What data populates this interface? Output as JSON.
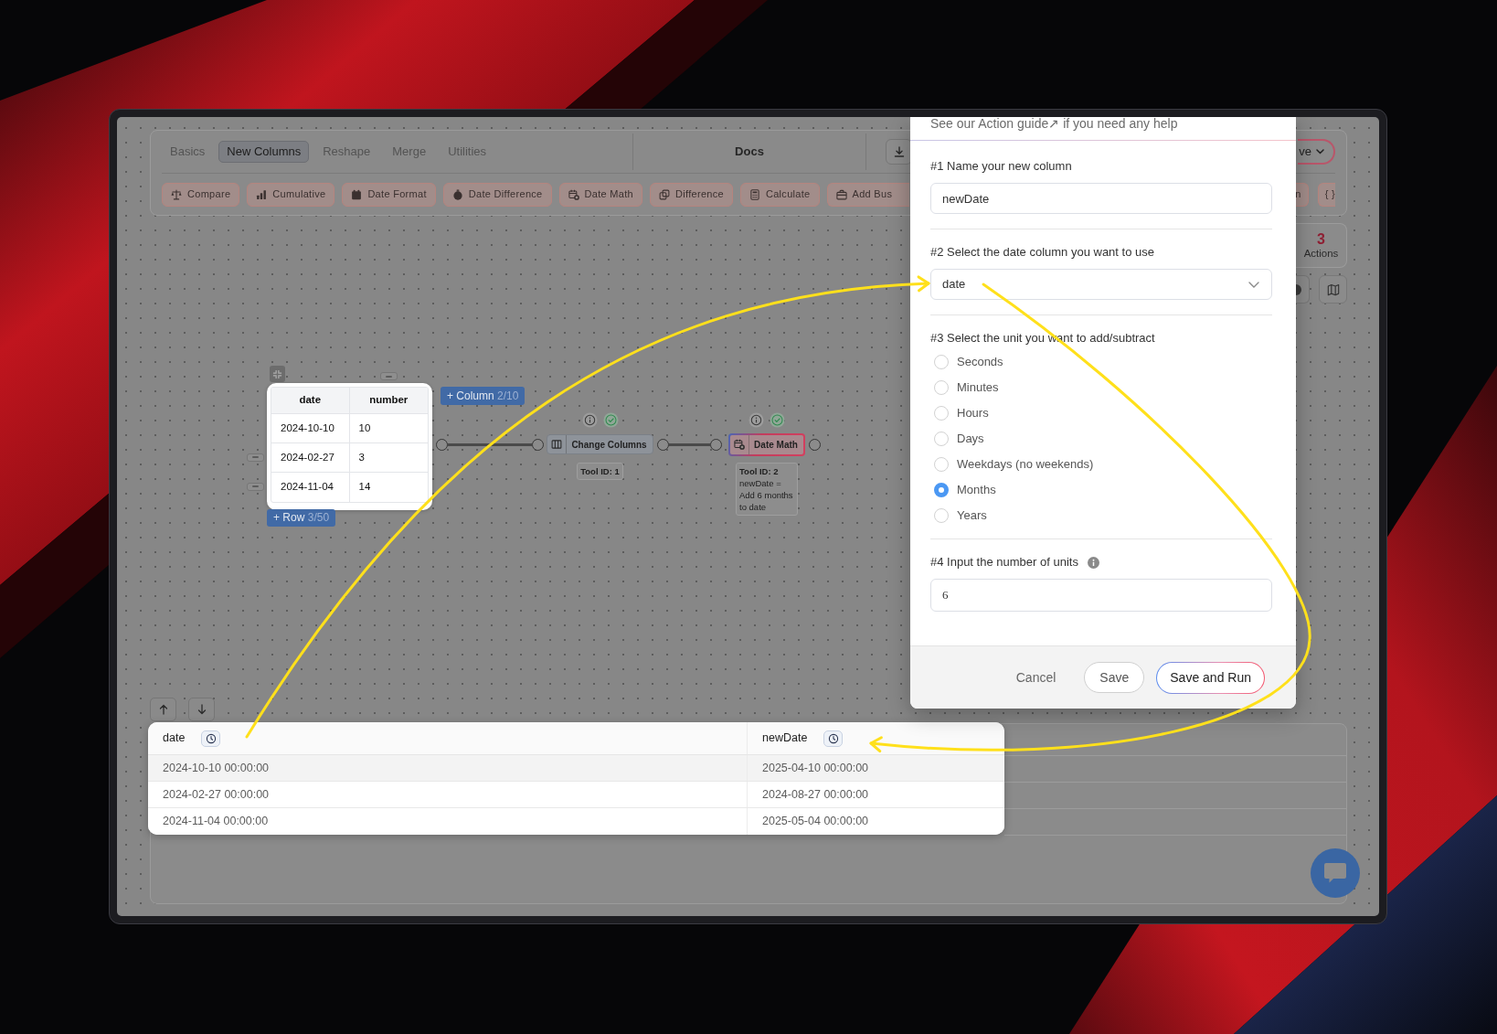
{
  "toolbar": {
    "tabs": [
      {
        "label": "Basics",
        "selected": false
      },
      {
        "label": "New Columns",
        "selected": true
      },
      {
        "label": "Reshape",
        "selected": false
      },
      {
        "label": "Merge",
        "selected": false
      },
      {
        "label": "Utilities",
        "selected": false
      }
    ],
    "docs": "Docs",
    "dropdown_button": "ve",
    "actions": [
      {
        "label": "Compare",
        "cut_left": false,
        "cut_right": false
      },
      {
        "label": "Cumulative",
        "cut_left": false,
        "cut_right": false
      },
      {
        "label": "Date Format",
        "cut_left": false,
        "cut_right": false
      },
      {
        "label": "Date Difference",
        "cut_left": false,
        "cut_right": false
      },
      {
        "label": "Date Math",
        "cut_left": false,
        "cut_right": false
      },
      {
        "label": "Difference",
        "cut_left": false,
        "cut_right": false
      },
      {
        "label": "Calculate",
        "cut_left": false,
        "cut_right": false
      },
      {
        "label": "Add Bus",
        "cut_left": false,
        "cut_right": true
      },
      {
        "label": "n",
        "cut_left": true,
        "cut_right": false
      },
      {
        "label": "{ }",
        "cut_left": false,
        "cut_right": true
      }
    ]
  },
  "input_table": {
    "columns": [
      {
        "label": "date",
        "remove_button": false
      },
      {
        "label": "number",
        "remove_button": true
      }
    ],
    "rows": [
      {
        "cells": [
          "2024-10-10",
          "10"
        ],
        "remove_button": false
      },
      {
        "cells": [
          "2024-02-27",
          "3"
        ],
        "remove_button": true
      },
      {
        "cells": [
          "2024-11-04",
          "14"
        ],
        "remove_button": true
      }
    ],
    "add_column": {
      "label": "+ Column",
      "count": "2/10"
    },
    "add_row": {
      "label": "+ Row",
      "count": "3/50"
    }
  },
  "nodes": [
    {
      "kind": "columns",
      "label": "Change Columns",
      "selected": false,
      "valid": true,
      "tool_id": "Tool ID: 1"
    },
    {
      "kind": "date",
      "label": "Date Math",
      "selected": true,
      "valid": true,
      "tool_id": "Tool ID: 2",
      "description": "newDate = Add 6 months to date"
    }
  ],
  "actions_panel": {
    "count": "3",
    "label": "Actions"
  },
  "result_table": {
    "columns": [
      "date",
      "newDate"
    ],
    "rows": [
      {
        "cells": [
          "2024-10-10 00:00:00",
          "2025-04-10 00:00:00"
        ],
        "highlighted": true
      },
      {
        "cells": [
          "2024-02-27 00:00:00",
          "2024-08-27 00:00:00"
        ],
        "highlighted": false
      },
      {
        "cells": [
          "2024-11-04 00:00:00",
          "2025-05-04 00:00:00"
        ],
        "highlighted": false
      }
    ]
  },
  "modal": {
    "help": {
      "before": "See our",
      "link": "Action guide↗",
      "after": "if you need any help"
    },
    "fields": [
      {
        "kind": "text",
        "label": "#1 Name your new column",
        "value": "newDate",
        "info": false
      },
      {
        "kind": "select",
        "label": "#2 Select the date column you want to use",
        "value": "date",
        "info": false
      },
      {
        "kind": "radio",
        "label": "#3 Select the unit you want to add/subtract",
        "info": false,
        "options": [
          {
            "label": "Seconds",
            "selected": false
          },
          {
            "label": "Minutes",
            "selected": false
          },
          {
            "label": "Hours",
            "selected": false
          },
          {
            "label": "Days",
            "selected": false
          },
          {
            "label": "Weekdays (no weekends)",
            "selected": false
          },
          {
            "label": "Months",
            "selected": true
          },
          {
            "label": "Years",
            "selected": false
          }
        ]
      },
      {
        "kind": "number",
        "label": "#4 Input the number of units",
        "value": "6",
        "info": true
      }
    ],
    "buttons": [
      {
        "kind": "link",
        "label": "Cancel"
      },
      {
        "kind": "outline",
        "label": "Save"
      },
      {
        "kind": "primary",
        "label": "Save and Run"
      }
    ]
  }
}
